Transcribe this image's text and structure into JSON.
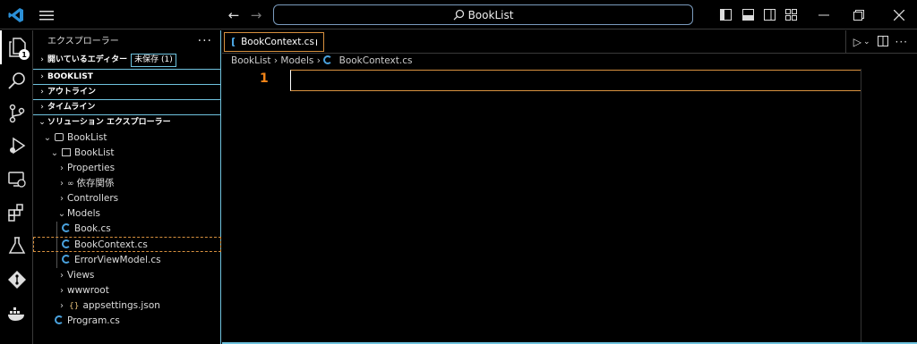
{
  "titlebar": {
    "search_text": "BookList"
  },
  "activity_bar": {
    "explorer_badge": "1"
  },
  "sidebar": {
    "title": "エクスプローラー",
    "more": "···",
    "sections": {
      "open_editors": "開いているエディター",
      "unsaved": "未保存 (1)",
      "booklist": "BOOKLIST",
      "outline": "アウトライン",
      "timeline": "タイムライン",
      "solution_explorer": "ソリューション エクスプローラー"
    },
    "tree": [
      {
        "label": "BookList"
      },
      {
        "label": "BookList"
      },
      {
        "label": "Properties"
      },
      {
        "label": "依存関係"
      },
      {
        "label": "Controllers"
      },
      {
        "label": "Models"
      },
      {
        "label": "Book.cs"
      },
      {
        "label": "BookContext.cs"
      },
      {
        "label": "ErrorViewModel.cs"
      },
      {
        "label": "Views"
      },
      {
        "label": "wwwroot"
      },
      {
        "label": "appsettings.json"
      },
      {
        "label": "Program.cs"
      }
    ]
  },
  "editor": {
    "tab_label": "BookContext.cs",
    "breadcrumb": {
      "part1": "BookList",
      "part2": "Models",
      "part3": "BookContext.cs"
    },
    "line_number": "1"
  },
  "colors": {
    "accent_border": "#6fc3df",
    "focus_orange": "#d8913f",
    "line_number": "#f38518"
  }
}
